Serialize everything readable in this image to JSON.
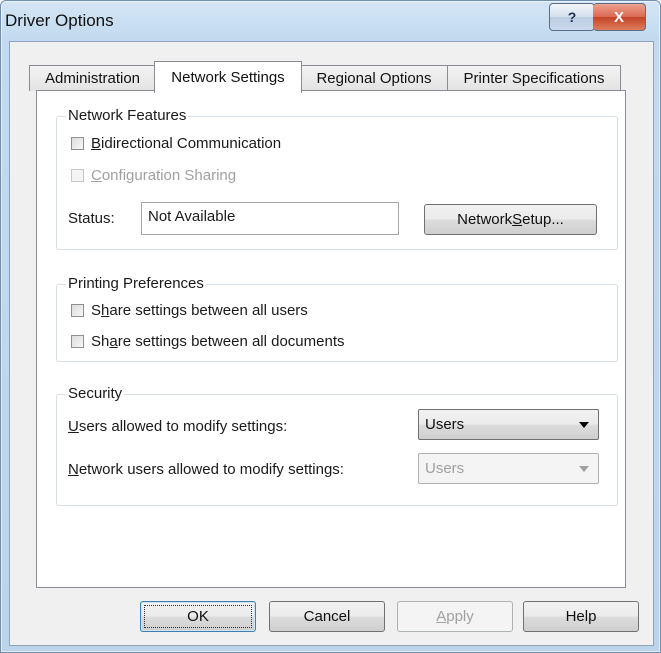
{
  "window": {
    "title": "Driver Options",
    "help_button_glyph": "?",
    "close_button_glyph": "X"
  },
  "tabs": [
    {
      "label": "Administration"
    },
    {
      "label": "Network Settings",
      "active": true
    },
    {
      "label": "Regional Options"
    },
    {
      "label": "Printer Specifications"
    }
  ],
  "network_features": {
    "legend": "Network Features",
    "bidirectional": {
      "mnemonic": "B",
      "rest": "idirectional Communication",
      "checked": false
    },
    "configuration_sharing": {
      "mnemonic": "C",
      "rest": "onfiguration Sharing",
      "checked": false,
      "disabled": true
    },
    "status_label": "Status:",
    "status_value": "Not Available",
    "setup_button": {
      "before": "Network ",
      "mnemonic": "S",
      "after": "etup..."
    }
  },
  "printing_preferences": {
    "legend": "Printing Preferences",
    "share_users": {
      "before": "S",
      "mnemonic": "h",
      "after": "are settings between all users",
      "checked": false
    },
    "share_documents": {
      "before": "Sh",
      "mnemonic": "a",
      "after": "re settings between all documents",
      "checked": false
    }
  },
  "security": {
    "legend": "Security",
    "users_label": {
      "mnemonic": "U",
      "rest": "sers allowed to modify settings:"
    },
    "users_value": "Users",
    "network_users_label": {
      "mnemonic": "N",
      "rest": "etwork users allowed to modify settings:"
    },
    "network_users_value": "Users"
  },
  "footer": {
    "ok": "OK",
    "cancel": "Cancel",
    "apply": {
      "mnemonic": "A",
      "rest": "pply"
    },
    "help": "Help"
  },
  "colors": {
    "title_bar": "#c2d9ee",
    "close_button": "#c5432a",
    "dialog_background": "#f0f0f0",
    "disabled_text": "#a0a0a0"
  }
}
